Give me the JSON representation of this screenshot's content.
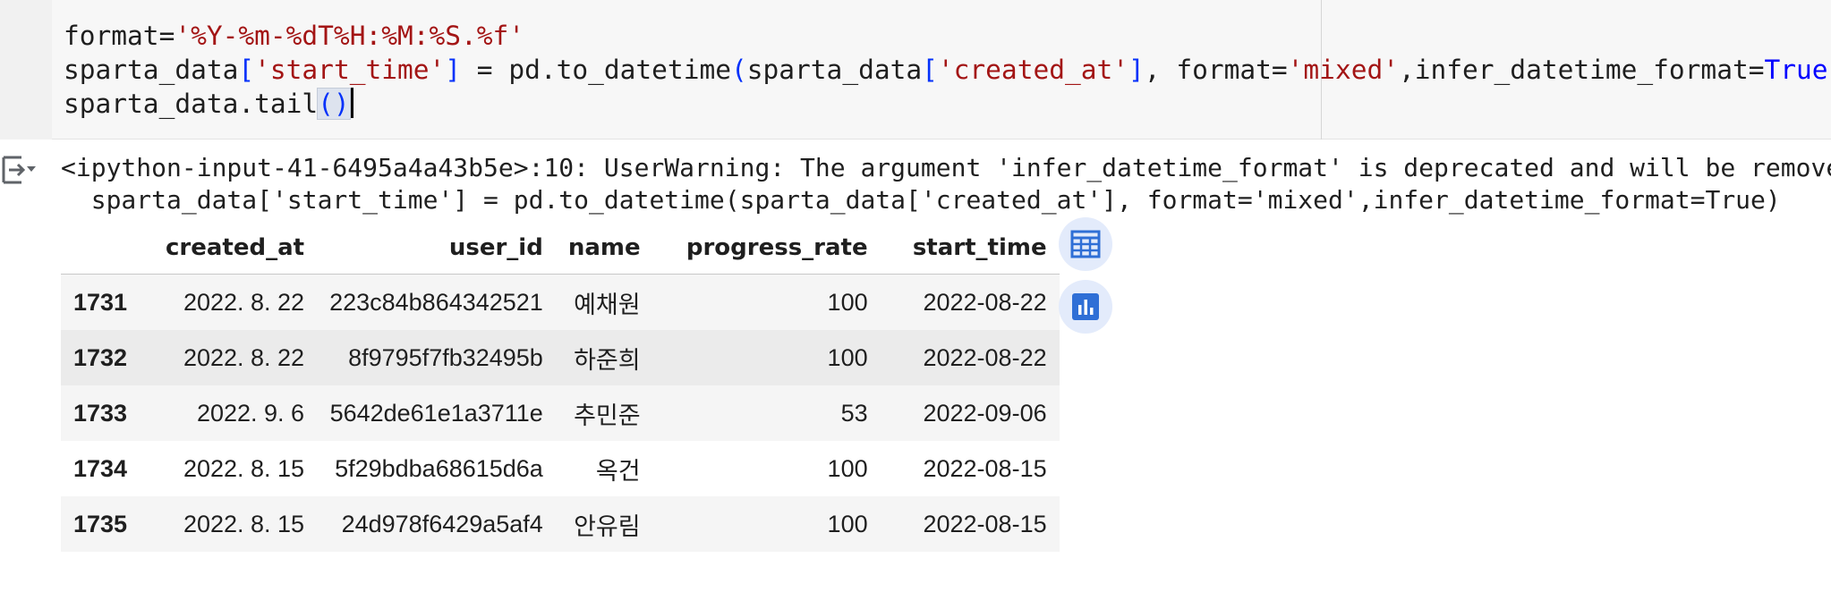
{
  "code": {
    "line1": {
      "var": "format=",
      "str": "'%Y-%m-%dT%H:%M:%S.%f'"
    },
    "line2": {
      "p1": "sparta_data",
      "b1": "[",
      "s1": "'start_time'",
      "b2": "]",
      "p2": " = pd.to_datetime",
      "b3": "(",
      "p3": "sparta_data",
      "b4": "[",
      "s2": "'created_at'",
      "b5": "]",
      "p4": ", format=",
      "s3": "'mixed'",
      "p5": ",infer_datetime_format=",
      "kw": "True",
      "b6": ")"
    },
    "line3": {
      "text": "sparta_data.tail",
      "parens": "()"
    }
  },
  "output": {
    "warning_line1": "<ipython-input-41-6495a4a43b5e>:10: UserWarning: The argument 'infer_datetime_format' is deprecated and will be remove",
    "warning_line2": "  sparta_data['start_time'] = pd.to_datetime(sparta_data['created_at'], format='mixed',infer_datetime_format=True)"
  },
  "table": {
    "columns": [
      "",
      "created_at",
      "user_id",
      "name",
      "progress_rate",
      "start_time"
    ],
    "rows": [
      {
        "index": "1731",
        "created_at": "2022. 8. 22",
        "user_id": "223c84b864342521",
        "name": "예채원",
        "progress_rate": "100",
        "start_time": "2022-08-22"
      },
      {
        "index": "1732",
        "created_at": "2022. 8. 22",
        "user_id": "8f9795f7fb32495b",
        "name": "하준희",
        "progress_rate": "100",
        "start_time": "2022-08-22"
      },
      {
        "index": "1733",
        "created_at": "2022. 9. 6",
        "user_id": "5642de61e1a3711e",
        "name": "추민준",
        "progress_rate": "53",
        "start_time": "2022-09-06"
      },
      {
        "index": "1734",
        "created_at": "2022. 8. 15",
        "user_id": "5f29bdba68615d6a",
        "name": "옥건",
        "progress_rate": "100",
        "start_time": "2022-08-15"
      },
      {
        "index": "1735",
        "created_at": "2022. 8. 15",
        "user_id": "24d978f6429a5af4",
        "name": "안유림",
        "progress_rate": "100",
        "start_time": "2022-08-15"
      }
    ]
  },
  "icons": {
    "output_toggle": "output-toggle-icon",
    "table_view": "table-icon",
    "chart_suggest": "bar-chart-icon"
  },
  "colors": {
    "string": "#a31515",
    "bracket": "#0431fa",
    "keyword": "#0000ff",
    "button_bg": "#e3ebfb",
    "button_fg": "#2f6fd6"
  }
}
